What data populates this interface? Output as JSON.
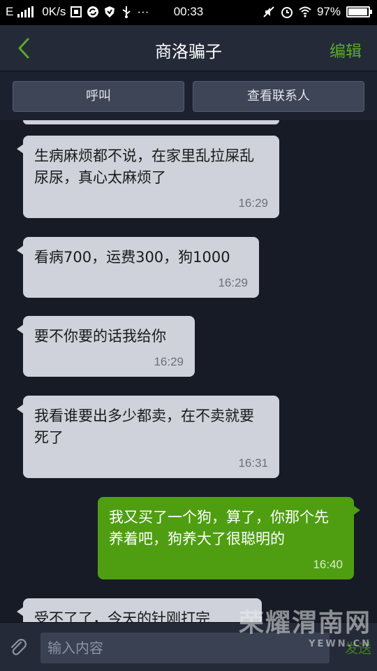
{
  "status_bar": {
    "network": "E",
    "speed": "0K/s",
    "extra": "···",
    "time": "00:33",
    "battery": "97%",
    "battery_level": 0.97
  },
  "header": {
    "title": "商洛骗子",
    "edit_label": "编辑"
  },
  "actions": {
    "call_label": "呼叫",
    "contact_label": "查看联系人"
  },
  "messages": [
    {
      "direction": "in",
      "text": "生病麻烦都不说，在家里乱拉屎乱尿尿，真心太麻烦了",
      "time": "16:29"
    },
    {
      "direction": "in",
      "text": "看病700，运费300，狗1000",
      "time": "16:29"
    },
    {
      "direction": "in",
      "text": "要不你要的话我给你",
      "time": "16:29"
    },
    {
      "direction": "in",
      "text": "我看谁要出多少都卖，在不卖就要死了",
      "time": "16:31"
    },
    {
      "direction": "out",
      "text": "我又买了一个狗，算了，你那个先养着吧，狗养大了很聪明的",
      "time": "16:40"
    },
    {
      "direction": "in",
      "text": "受不了了，今天的针刚打完",
      "time": ""
    }
  ],
  "input": {
    "placeholder": "输入内容",
    "send_label": "发送"
  },
  "watermark": {
    "main": "荣耀渭南网",
    "sub": "YEWN.CN"
  },
  "colors": {
    "accent": "#5aaa2a",
    "outgoing_bubble": "#4f9e12",
    "incoming_bubble": "#cfd2da",
    "background": "#171b26"
  },
  "icons": [
    "signal-icon",
    "screenshot-icon",
    "sync-icon",
    "shield-icon",
    "usb-icon",
    "mute-icon",
    "alarm-icon",
    "wifi-icon",
    "battery-icon",
    "back-icon",
    "attachment-icon"
  ]
}
